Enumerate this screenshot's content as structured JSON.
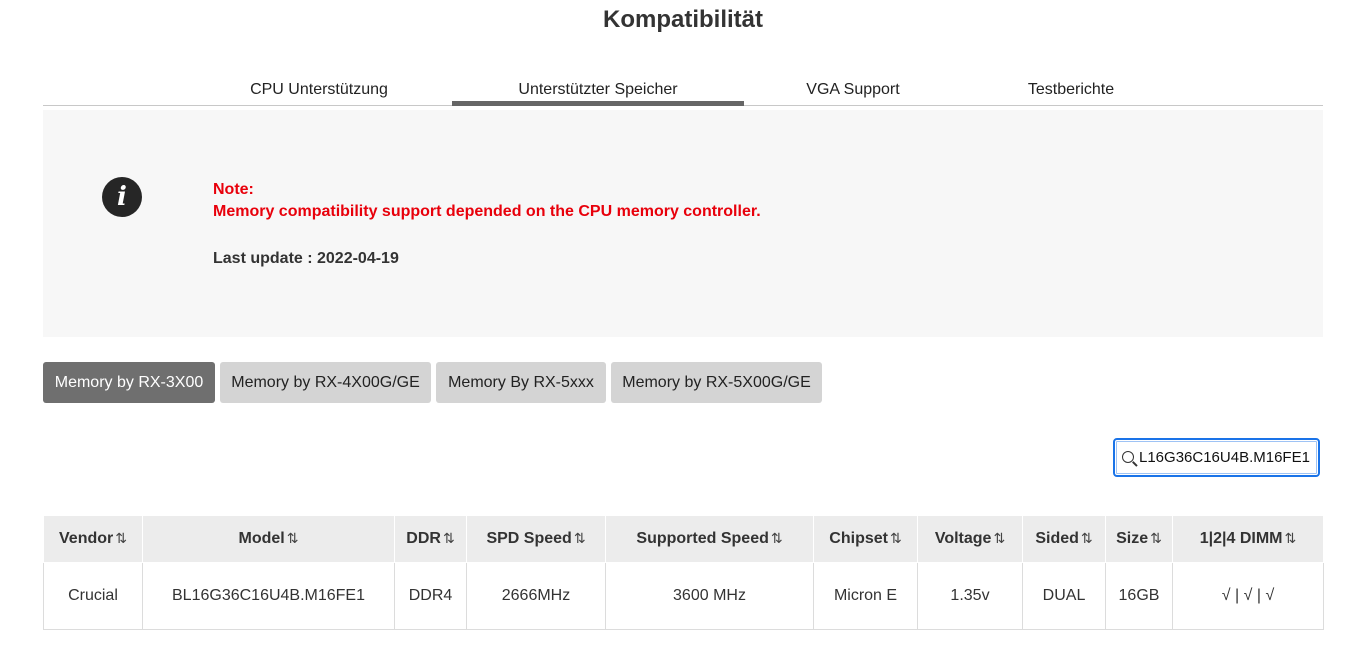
{
  "page": {
    "title": "Kompatibilität"
  },
  "tabs": [
    {
      "label": "CPU Unterstützung",
      "active": false
    },
    {
      "label": "Unterstützter Speicher",
      "active": true
    },
    {
      "label": "VGA Support",
      "active": false
    },
    {
      "label": "Testberichte",
      "active": false
    }
  ],
  "note": {
    "icon": "info-icon",
    "label": "Note:",
    "text": "Memory compatibility support depended on the CPU memory controller.",
    "last_update": "Last update : 2022-04-19"
  },
  "memory_buttons": [
    {
      "label": "Memory by RX-3X00",
      "active": true
    },
    {
      "label": "Memory by RX-4X00G/GE",
      "active": false
    },
    {
      "label": "Memory By RX-5xxx",
      "active": false
    },
    {
      "label": "Memory by RX-5X00G/GE",
      "active": false
    }
  ],
  "search": {
    "value": "L16G36C16U4B.M16FE1",
    "icon": "search-icon"
  },
  "table": {
    "sort_icon": "⇅",
    "headers": [
      "Vendor",
      "Model",
      "DDR",
      "SPD Speed",
      "Supported Speed",
      "Chipset",
      "Voltage",
      "Sided",
      "Size",
      "1|2|4 DIMM"
    ],
    "rows": [
      [
        "Crucial",
        "BL16G36C16U4B.M16FE1",
        "DDR4",
        "2666MHz",
        "3600 MHz",
        "Micron E",
        "1.35v",
        "DUAL",
        "16GB",
        "√ | √ | √"
      ]
    ]
  },
  "colors": {
    "note_red": "#e8000b",
    "active_button": "#6f6f6f",
    "inactive_button": "#d4d4d4",
    "search_focus": "#1a73e8"
  }
}
